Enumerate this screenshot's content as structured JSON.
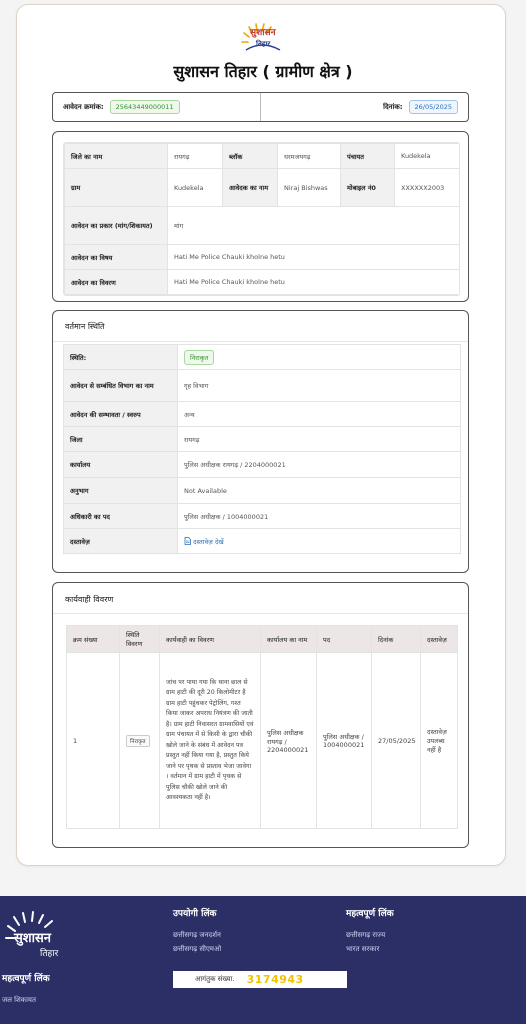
{
  "header": {
    "logo_text": "सुशासन",
    "logo_subtext": "तिहार",
    "page_title": "सुशासन तिहार ( ग्रामीण क्षेत्र )"
  },
  "application_bar": {
    "app_no_label": "आवेदन क्रमांक:",
    "app_no_value": "25643449000011",
    "date_label": "दिनांक:",
    "date_value": "26/05/2025"
  },
  "applicant_details": {
    "district_label": "जिले का नाम",
    "district_value": "रायगढ़",
    "block_label": "ब्लॉक",
    "block_value": "धरमजयगढ़",
    "panchayat_label": "पंचायत",
    "panchayat_value": "Kudekela",
    "village_label": "ग्राम",
    "village_value": "Kudekela",
    "applicant_name_label": "आवेदक का नाम",
    "applicant_name_value": "Niraj Bishwas",
    "mobile_label": "मोबाइल नं0",
    "mobile_value": "XXXXXX2003",
    "type_label": "आवेदन का प्रकार (मांग/शिकायत)",
    "type_value": "मांग",
    "subject_label": "आवेदन का विषय",
    "subject_value": "Hati Me Police Chauki kholne hetu",
    "detail_label": "आवेदन का विवरण",
    "detail_value": "Hati Me Police Chauki kholne hetu"
  },
  "current_status": {
    "section_title": "वर्तमान स्थिति",
    "status_label": "स्थिति:",
    "status_value": "निराकृत",
    "dept_label": "आवेदन से सम्बंधित विभाग का नाम",
    "dept_value": "गृह विभाग",
    "nature_label": "आवेदन की सम्भावता / स्वरुप",
    "nature_value": "अन्य",
    "district_label": "जिला",
    "district_value": "रायगढ़",
    "office_label": "कार्यालय",
    "office_value": "पुलिस अधीक्षक रायगढ़ / 2204000021",
    "subdivision_label": "अनुभाग",
    "subdivision_value": "Not Available",
    "officer_label": "अधिकारी का पद",
    "officer_value": "पुलिस अधीक्षक / 1004000021",
    "document_label": "दस्तावेज़",
    "document_link": "दस्तावेज़ देखें"
  },
  "action_details": {
    "section_title": "कार्यवाही विवरण",
    "headers": [
      "क्रम संख्या",
      "स्थिति विवरण",
      "कार्यवाही का विवरण",
      "कार्यालय का नाम",
      "पद",
      "दिनांक",
      "दस्तावेज़"
    ],
    "rows": [
      {
        "sno": "1",
        "status": "निराकृत",
        "description": "जांच पर पाया गया कि थाना छाल से ग्राम हाटी की दूरी 20 किलोमीटर है ग्राम हाटी पहुंचकर पेट्रोलिंग, गश्त किया जाकर अपराध नियंत्रण की जाती है। ग्राम हाटी निवासरत ग्रामवासियों एवं ग्राम पंचायत में से किसी के द्वारा चौकी खोले जाने के संबंध में आवेदन पत्र प्रस्तुत नहीं किया गया है, प्रस्तुत किये जाने पर पृथक से प्रस्ताव भेजा जावेगा । वर्तमान में ग्राम हाटी में पृथक से पुलिस चौकी खोले जाने की आवश्यकता नहीं है।",
        "office": "पुलिस अधीक्षक रायगढ़ / 2204000021",
        "post": "पुलिस अधीक्षक / 1004000021",
        "date": "27/05/2025",
        "document": "दस्तावेज़ उपलब्ध नहीं है"
      }
    ]
  },
  "footer": {
    "logo_text": "सुशासन",
    "logo_subtext": "तिहार",
    "useful_links_title": "उपयोगी लिंक",
    "useful_links": [
      "छत्तीसगढ़ जनदर्शन",
      "छत्तीसगढ़ सीएमओ"
    ],
    "important_links_title": "महत्वपूर्ण लिंक",
    "important_links": [
      "छत्तीसगढ़ राज्य",
      "भारत सरकार"
    ],
    "left_heading": "महत्वपूर्ण लिंक",
    "left_link": "जल शिकायत",
    "visitor_label": "आगंतुक संख्या.",
    "visitor_count": "3174943"
  },
  "colors": {
    "footer_bg": "#2b2f66",
    "status_green": "#3a8c34",
    "date_blue": "#2a6fb8",
    "visitor_yellow": "#f2c200"
  }
}
